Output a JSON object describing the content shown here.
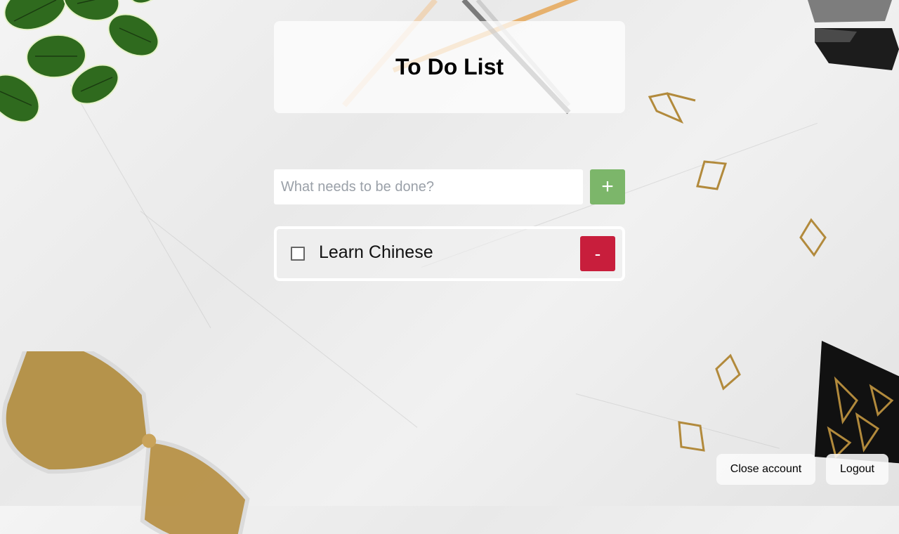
{
  "header": {
    "title": "To Do List"
  },
  "new_todo": {
    "placeholder": "What needs to be done?",
    "value": "",
    "add_label": "+"
  },
  "todos": [
    {
      "text": "Learn Chinese",
      "done": false,
      "remove_label": "-"
    }
  ],
  "account": {
    "close_label": "Close account",
    "logout_label": "Logout"
  },
  "colors": {
    "add": "#7cb66a",
    "remove": "#c81e3c"
  }
}
